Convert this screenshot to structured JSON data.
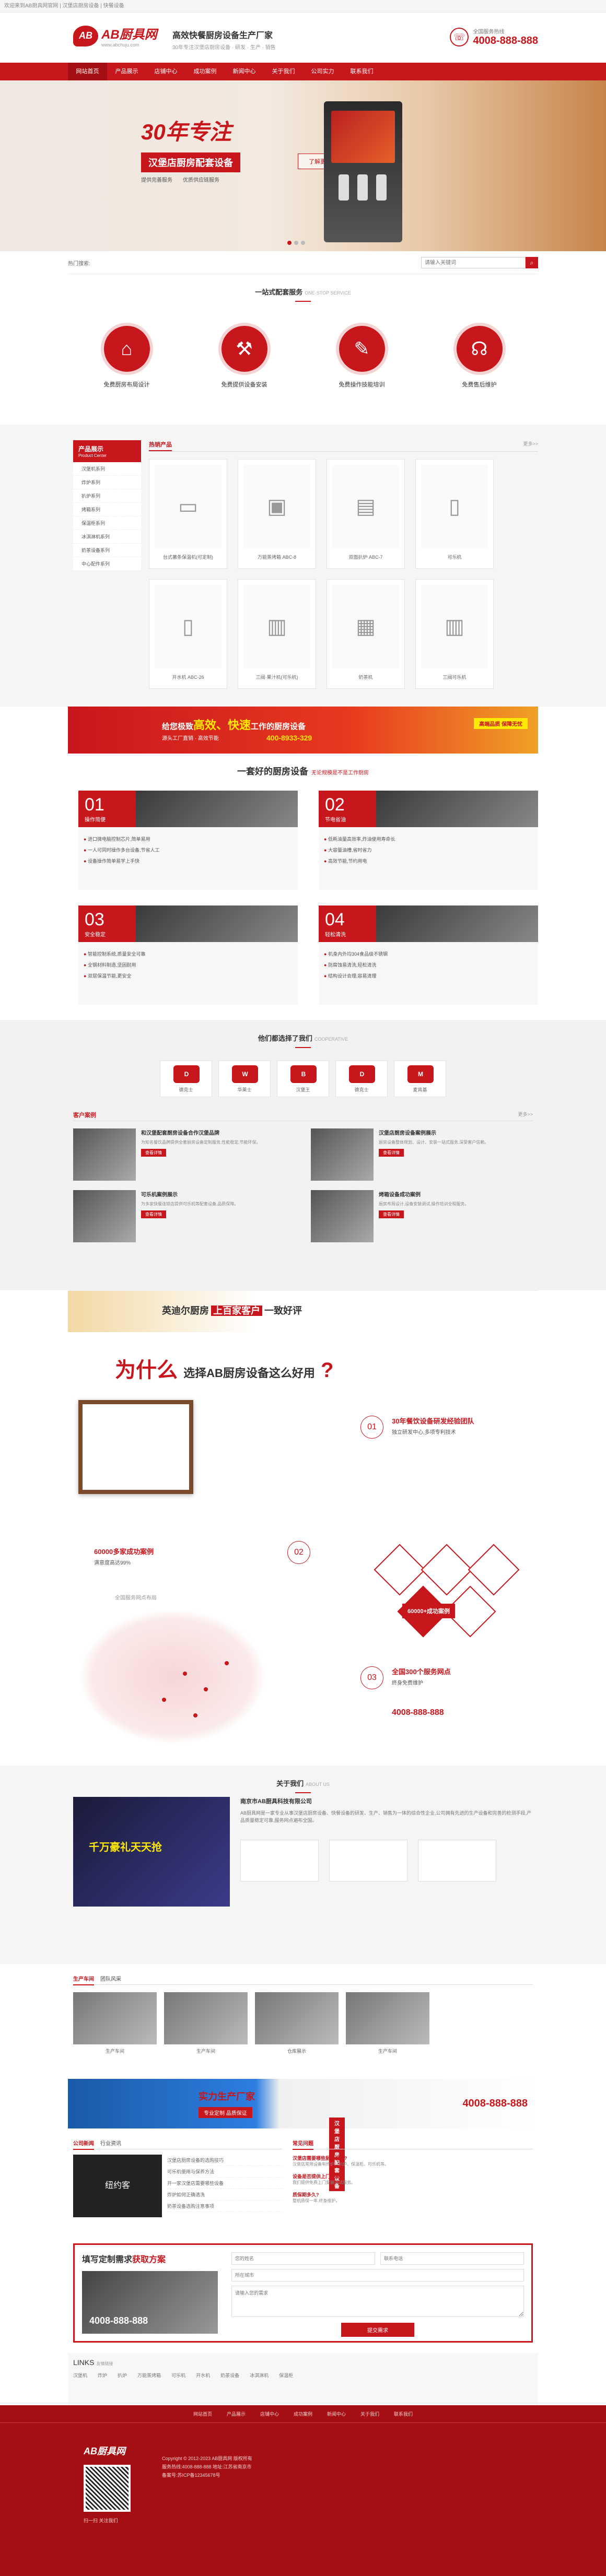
{
  "topbar": {
    "text": "欢迎来到AB厨具网官网 | 汉堡店厨房设备 | 快餐设备"
  },
  "header": {
    "logo": "AB厨具网",
    "logo_sub": "www.abchuju.com",
    "slogan": "高效快餐厨房设备生产厂家",
    "slogan_sub": "30年专注汉堡店厨房设备 · 研发 · 生产 · 销售",
    "hotline_label": "全国服务热线",
    "hotline": "4008-888-888"
  },
  "nav": [
    "网站首页",
    "产品展示",
    "店铺中心",
    "成功案例",
    "新闻中心",
    "关于我们",
    "公司实力",
    "联系我们"
  ],
  "banner": {
    "heading": "30年专注",
    "tag": "汉堡店厨房配套设备",
    "pts": [
      "提供完善服务",
      "优质供应链服务"
    ],
    "btn": "了解更多"
  },
  "search": {
    "hot": "热门搜索:",
    "placeholder": "请输入关键词"
  },
  "services": {
    "title": "一站式配套服务",
    "sub": "ONE-STOP SERVICE",
    "items": [
      "免费厨房布局设计",
      "免费提供设备安装",
      "免费操作技能培训",
      "免费售后维护"
    ]
  },
  "products": {
    "side_title": "产品展示",
    "side_sub": "Product Center",
    "side_items": [
      "汉堡机系列",
      "炸炉系列",
      "扒炉系列",
      "烤箱系列",
      "保温柜系列",
      "冰淇淋机系列",
      "奶茶设备系列",
      "中心配件系列"
    ],
    "tab": "热销产品",
    "more": "更多>>",
    "items": [
      "台式薯条保温机(可定制)",
      "万能蒸烤箱 ABC-8",
      "双面扒炉 ABC-7",
      "可乐机",
      "开水机 ABC-26",
      "三阀·果汁机(可乐机)",
      "奶茶机",
      "三阀可乐机"
    ]
  },
  "ad1": {
    "line1a": "给您极致",
    "line1b": "高效、快速",
    "line1c": "工作的厨房设备",
    "line2": "源头工厂直销 · 高效节能",
    "phone": "400-8933-329",
    "tag": "高端品质 保障无忧"
  },
  "system": {
    "title": "一套好的厨房设备",
    "sub": "无论规模是不是工作厨房",
    "items": [
      {
        "n": "01",
        "t": "操作简便",
        "pts": [
          "进口微电脑控制芯片,简单易用",
          "一人可同时操作多台设备,节省人工",
          "设备操作简单易学上手快"
        ]
      },
      {
        "n": "02",
        "t": "节电省油",
        "pts": [
          "低耗油量高效率,炸油使用寿命长",
          "大容量油槽,省时省力",
          "高效节能,节约用电"
        ]
      },
      {
        "n": "03",
        "t": "安全稳定",
        "pts": [
          "智能控制系统,质量安全可靠",
          "全钢材料制造,坚固耐用",
          "双层保温节能,更安全"
        ]
      },
      {
        "n": "04",
        "t": "轻松清洗",
        "pts": [
          "机身内外均304食品级不锈钢",
          "防腐蚀易清洗,轻松清洗",
          "结构设计合理,容易清理"
        ]
      }
    ]
  },
  "clients": {
    "title": "他们都选择了我们",
    "sub": "COOPERATIVE",
    "logos": [
      "德克士",
      "华莱士",
      "汉堡王",
      "德克士",
      "麦肯基"
    ],
    "cases_tab": "客户案例",
    "cases_more": "更多>>",
    "cases": [
      {
        "t": "和汉堡配套厨房设备合作汉堡品牌",
        "d": "为知名餐饮品牌提供全套厨房设备定制服务,性能稳定,节能环保。",
        "m": "查看详情"
      },
      {
        "t": "汉堡店厨房设备案例展示",
        "d": "厨房设备整体规划、设计、安装一站式服务,深受客户信赖。",
        "m": "查看详情"
      },
      {
        "t": "可乐机案例展示",
        "d": "为多家快餐连锁店提供可乐机等配套设备,品质保障。",
        "m": "查看详情"
      },
      {
        "t": "烤箱设备成功案例",
        "d": "厨房布局设计,设备安装调试,操作培训全程服务。",
        "m": "查看详情"
      }
    ]
  },
  "band2": {
    "pre": "英迪尔厨房",
    "hl": "上百家客户",
    "post": "一致好评"
  },
  "why": {
    "title": "为什么",
    "title2": "选择AB厨房设备这么好用",
    "items": [
      {
        "n": "01",
        "h": "30年餐饮设备研发经验团队",
        "s": "独立研发中心,多项专利技术"
      },
      {
        "n": "02",
        "h": "60000多家成功案例",
        "s": "满意度高达99%"
      },
      {
        "n": "03",
        "h": "全国300个服务网点",
        "s": "终身免费维护"
      }
    ],
    "case_badge": "60000+成功案例",
    "map_label": "全国服务网点布局",
    "phone": "4008-888-888"
  },
  "about": {
    "title": "关于我们",
    "sub": "ABOUT US",
    "video_text": "千万豪礼天天抢",
    "company": "南京市AB厨具科技有限公司",
    "desc": "AB厨具网是一家专业从事汉堡店厨房设备、快餐设备的研发、生产、销售为一体的综合性企业,公司拥有先进的生产设备和完善的检测手段,产品质量稳定可靠,服务网点遍布全国。"
  },
  "factory": {
    "tabs": [
      "生产车间",
      "团队风采"
    ],
    "items": [
      "生产车间",
      "生产车间",
      "仓库展示",
      "生产车间"
    ]
  },
  "ad3": {
    "t1": "汉堡店厨房配套设备",
    "t2": "实力生产厂家",
    "btn": "专业定制 品质保证",
    "phone": "4008-888-888"
  },
  "news": {
    "tabs": [
      "公司新闻",
      "行业资讯"
    ],
    "img_text": "纽约客",
    "items": [
      "汉堡店厨房设备的选购技巧",
      "可乐机使用与保养方法",
      "开一家汉堡店需要哪些设备",
      "炸炉如何正确清洗",
      "奶茶设备选购注意事项"
    ],
    "faq_tab": "常见问题",
    "faq": [
      {
        "q": "汉堡店需要哪些厨房设备?",
        "a": "汉堡店常用设备有炸炉、扒炉、保温柜、可乐机等。"
      },
      {
        "q": "设备是否提供上门安装?",
        "a": "我们提供免费上门安装调试服务。"
      },
      {
        "q": "质保期多久?",
        "a": "整机质保一年,终身维护。"
      }
    ]
  },
  "form": {
    "title_a": "填写定制需求",
    "title_b": "获取方案",
    "phone": "4008-888-888",
    "f1": "您的姓名",
    "f2": "联系电话",
    "f3": "所在城市",
    "f4": "请输入您的需求",
    "btn": "提交需求"
  },
  "links": {
    "title": "LINKS",
    "sub": "友情链接",
    "items": [
      "汉堡机",
      "炸炉",
      "扒炉",
      "万能蒸烤箱",
      "可乐机",
      "开水机",
      "奶茶设备",
      "冰淇淋机",
      "保温柜"
    ]
  },
  "footer": {
    "nav": [
      "网站首页",
      "产品展示",
      "店铺中心",
      "成功案例",
      "新闻中心",
      "关于我们",
      "联系我们"
    ],
    "logo": "AB厨具网",
    "qr_label": "扫一扫 关注我们",
    "info": [
      "Copyright © 2012-2023 AB厨具网 版权所有",
      "服务热线:4008-888-888  地址:江苏省南京市",
      "备案号:苏ICP备12345678号"
    ]
  }
}
